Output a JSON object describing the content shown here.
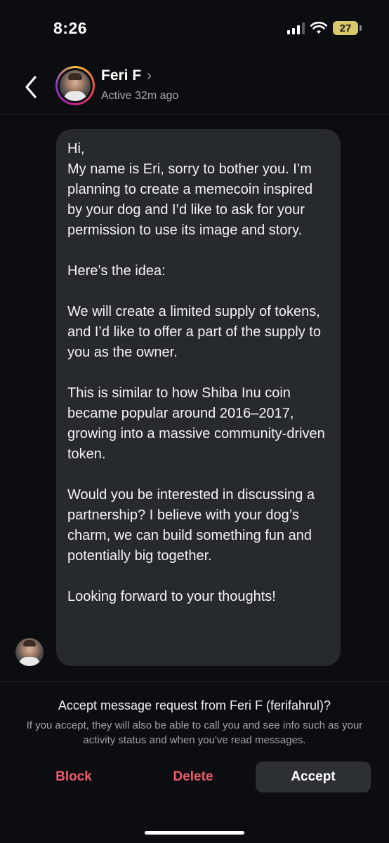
{
  "status_bar": {
    "time": "8:26",
    "battery_level": "27",
    "icons": [
      "signal-icon",
      "wifi-icon",
      "battery-icon"
    ]
  },
  "header": {
    "back_icon": "chevron-left-icon",
    "contact_name": "Feri F",
    "name_chevron": "›",
    "active_status": "Active 32m ago"
  },
  "message": {
    "paragraphs": [
      "Hi,\nMy name is Eri, sorry to bother you. I’m planning to create a memecoin inspired by your dog and I’d like to ask for your permission to use its image and story.",
      "Here’s the idea:",
      "We will create a limited supply of tokens, and I’d like to offer a part of the supply to you as the owner.",
      "This is similar to how Shiba Inu coin became popular around 2016–2017, growing into a massive community-driven token.",
      "Would you be interested in discussing a partnership? I believe with your dog’s charm, we can build something fun and potentially big together.",
      "Looking forward to your thoughts!"
    ]
  },
  "request": {
    "title": "Accept message request from Feri F (ferifahrul)?",
    "info": "If you accept, they will also be able to call you and see info such as your activity status and when you've read messages.",
    "block_label": "Block",
    "delete_label": "Delete",
    "accept_label": "Accept"
  },
  "colors": {
    "background": "#0b0d10",
    "bubble": "#26292e",
    "danger": "#ee5b6c",
    "accept_button": "#2c2f34",
    "battery": "#d8c86a"
  }
}
